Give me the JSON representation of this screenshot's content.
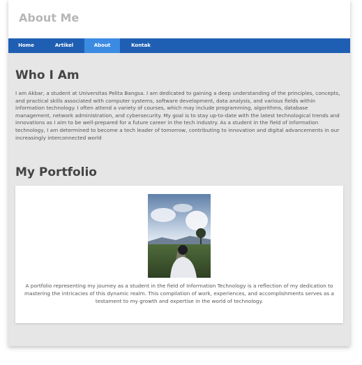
{
  "header": {
    "title": "About Me"
  },
  "nav": {
    "items": [
      {
        "label": "Home"
      },
      {
        "label": "Artikel"
      },
      {
        "label": "About"
      },
      {
        "label": "Kontak"
      }
    ],
    "active": "About"
  },
  "about": {
    "heading": "Who I Am",
    "text": "I am Akbar, a student at Universitas Pelita Bangsa. I am dedicated to gaining a deep understanding of the principles, concepts, and practical skills associated with computer systems, software development, data analysis, and various fields within information technology. I often attend a variety of courses, which may include programming, algorithms, database management, network administration, and cybersecurity. My goal is to stay up-to-date with the latest technological trends and innovations as I aim to be well-prepared for a future career in the tech industry. As a student in the field of information technology, I am determined to become a tech leader of tomorrow, contributing to innovation and digital advancements in our increasingly interconnected world"
  },
  "portfolio": {
    "heading": "My Portfolio",
    "caption": "A portfolio representing my journey as a student in the field of Information Technology is a reflection of my dedication to mastering the intricacies of this dynamic realm. This compilation of work, experiences, and accomplishments serves as a testament to my growth and expertise in the world of technology."
  },
  "colors": {
    "nav": "#1f5fb3",
    "nav_active": "#3b8be3",
    "page_bg": "#e6e6e6"
  }
}
